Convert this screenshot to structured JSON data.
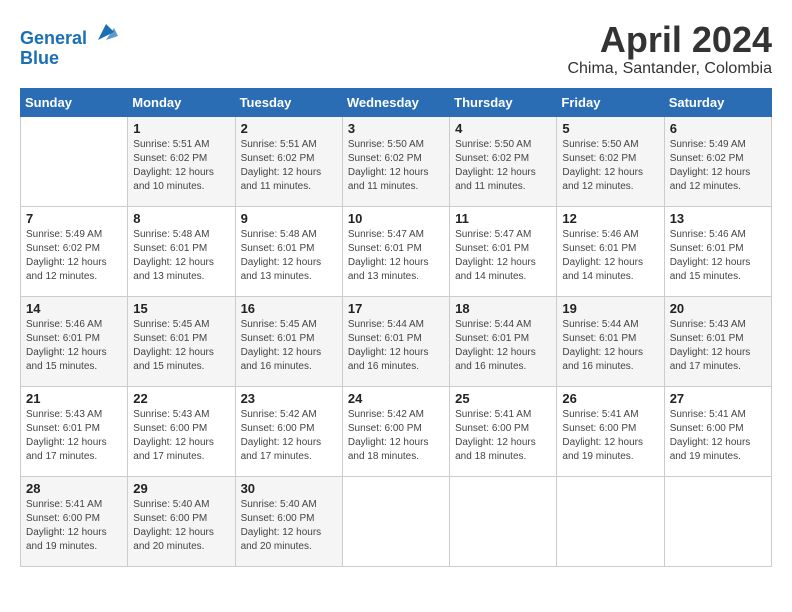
{
  "logo": {
    "line1": "General",
    "line2": "Blue"
  },
  "title": "April 2024",
  "location": "Chima, Santander, Colombia",
  "weekdays": [
    "Sunday",
    "Monday",
    "Tuesday",
    "Wednesday",
    "Thursday",
    "Friday",
    "Saturday"
  ],
  "weeks": [
    [
      {
        "num": "",
        "detail": ""
      },
      {
        "num": "1",
        "detail": "Sunrise: 5:51 AM\nSunset: 6:02 PM\nDaylight: 12 hours\nand 10 minutes."
      },
      {
        "num": "2",
        "detail": "Sunrise: 5:51 AM\nSunset: 6:02 PM\nDaylight: 12 hours\nand 11 minutes."
      },
      {
        "num": "3",
        "detail": "Sunrise: 5:50 AM\nSunset: 6:02 PM\nDaylight: 12 hours\nand 11 minutes."
      },
      {
        "num": "4",
        "detail": "Sunrise: 5:50 AM\nSunset: 6:02 PM\nDaylight: 12 hours\nand 11 minutes."
      },
      {
        "num": "5",
        "detail": "Sunrise: 5:50 AM\nSunset: 6:02 PM\nDaylight: 12 hours\nand 12 minutes."
      },
      {
        "num": "6",
        "detail": "Sunrise: 5:49 AM\nSunset: 6:02 PM\nDaylight: 12 hours\nand 12 minutes."
      }
    ],
    [
      {
        "num": "7",
        "detail": "Sunrise: 5:49 AM\nSunset: 6:02 PM\nDaylight: 12 hours\nand 12 minutes."
      },
      {
        "num": "8",
        "detail": "Sunrise: 5:48 AM\nSunset: 6:01 PM\nDaylight: 12 hours\nand 13 minutes."
      },
      {
        "num": "9",
        "detail": "Sunrise: 5:48 AM\nSunset: 6:01 PM\nDaylight: 12 hours\nand 13 minutes."
      },
      {
        "num": "10",
        "detail": "Sunrise: 5:47 AM\nSunset: 6:01 PM\nDaylight: 12 hours\nand 13 minutes."
      },
      {
        "num": "11",
        "detail": "Sunrise: 5:47 AM\nSunset: 6:01 PM\nDaylight: 12 hours\nand 14 minutes."
      },
      {
        "num": "12",
        "detail": "Sunrise: 5:46 AM\nSunset: 6:01 PM\nDaylight: 12 hours\nand 14 minutes."
      },
      {
        "num": "13",
        "detail": "Sunrise: 5:46 AM\nSunset: 6:01 PM\nDaylight: 12 hours\nand 15 minutes."
      }
    ],
    [
      {
        "num": "14",
        "detail": "Sunrise: 5:46 AM\nSunset: 6:01 PM\nDaylight: 12 hours\nand 15 minutes."
      },
      {
        "num": "15",
        "detail": "Sunrise: 5:45 AM\nSunset: 6:01 PM\nDaylight: 12 hours\nand 15 minutes."
      },
      {
        "num": "16",
        "detail": "Sunrise: 5:45 AM\nSunset: 6:01 PM\nDaylight: 12 hours\nand 16 minutes."
      },
      {
        "num": "17",
        "detail": "Sunrise: 5:44 AM\nSunset: 6:01 PM\nDaylight: 12 hours\nand 16 minutes."
      },
      {
        "num": "18",
        "detail": "Sunrise: 5:44 AM\nSunset: 6:01 PM\nDaylight: 12 hours\nand 16 minutes."
      },
      {
        "num": "19",
        "detail": "Sunrise: 5:44 AM\nSunset: 6:01 PM\nDaylight: 12 hours\nand 16 minutes."
      },
      {
        "num": "20",
        "detail": "Sunrise: 5:43 AM\nSunset: 6:01 PM\nDaylight: 12 hours\nand 17 minutes."
      }
    ],
    [
      {
        "num": "21",
        "detail": "Sunrise: 5:43 AM\nSunset: 6:01 PM\nDaylight: 12 hours\nand 17 minutes."
      },
      {
        "num": "22",
        "detail": "Sunrise: 5:43 AM\nSunset: 6:00 PM\nDaylight: 12 hours\nand 17 minutes."
      },
      {
        "num": "23",
        "detail": "Sunrise: 5:42 AM\nSunset: 6:00 PM\nDaylight: 12 hours\nand 17 minutes."
      },
      {
        "num": "24",
        "detail": "Sunrise: 5:42 AM\nSunset: 6:00 PM\nDaylight: 12 hours\nand 18 minutes."
      },
      {
        "num": "25",
        "detail": "Sunrise: 5:41 AM\nSunset: 6:00 PM\nDaylight: 12 hours\nand 18 minutes."
      },
      {
        "num": "26",
        "detail": "Sunrise: 5:41 AM\nSunset: 6:00 PM\nDaylight: 12 hours\nand 19 minutes."
      },
      {
        "num": "27",
        "detail": "Sunrise: 5:41 AM\nSunset: 6:00 PM\nDaylight: 12 hours\nand 19 minutes."
      }
    ],
    [
      {
        "num": "28",
        "detail": "Sunrise: 5:41 AM\nSunset: 6:00 PM\nDaylight: 12 hours\nand 19 minutes."
      },
      {
        "num": "29",
        "detail": "Sunrise: 5:40 AM\nSunset: 6:00 PM\nDaylight: 12 hours\nand 20 minutes."
      },
      {
        "num": "30",
        "detail": "Sunrise: 5:40 AM\nSunset: 6:00 PM\nDaylight: 12 hours\nand 20 minutes."
      },
      {
        "num": "",
        "detail": ""
      },
      {
        "num": "",
        "detail": ""
      },
      {
        "num": "",
        "detail": ""
      },
      {
        "num": "",
        "detail": ""
      }
    ]
  ]
}
